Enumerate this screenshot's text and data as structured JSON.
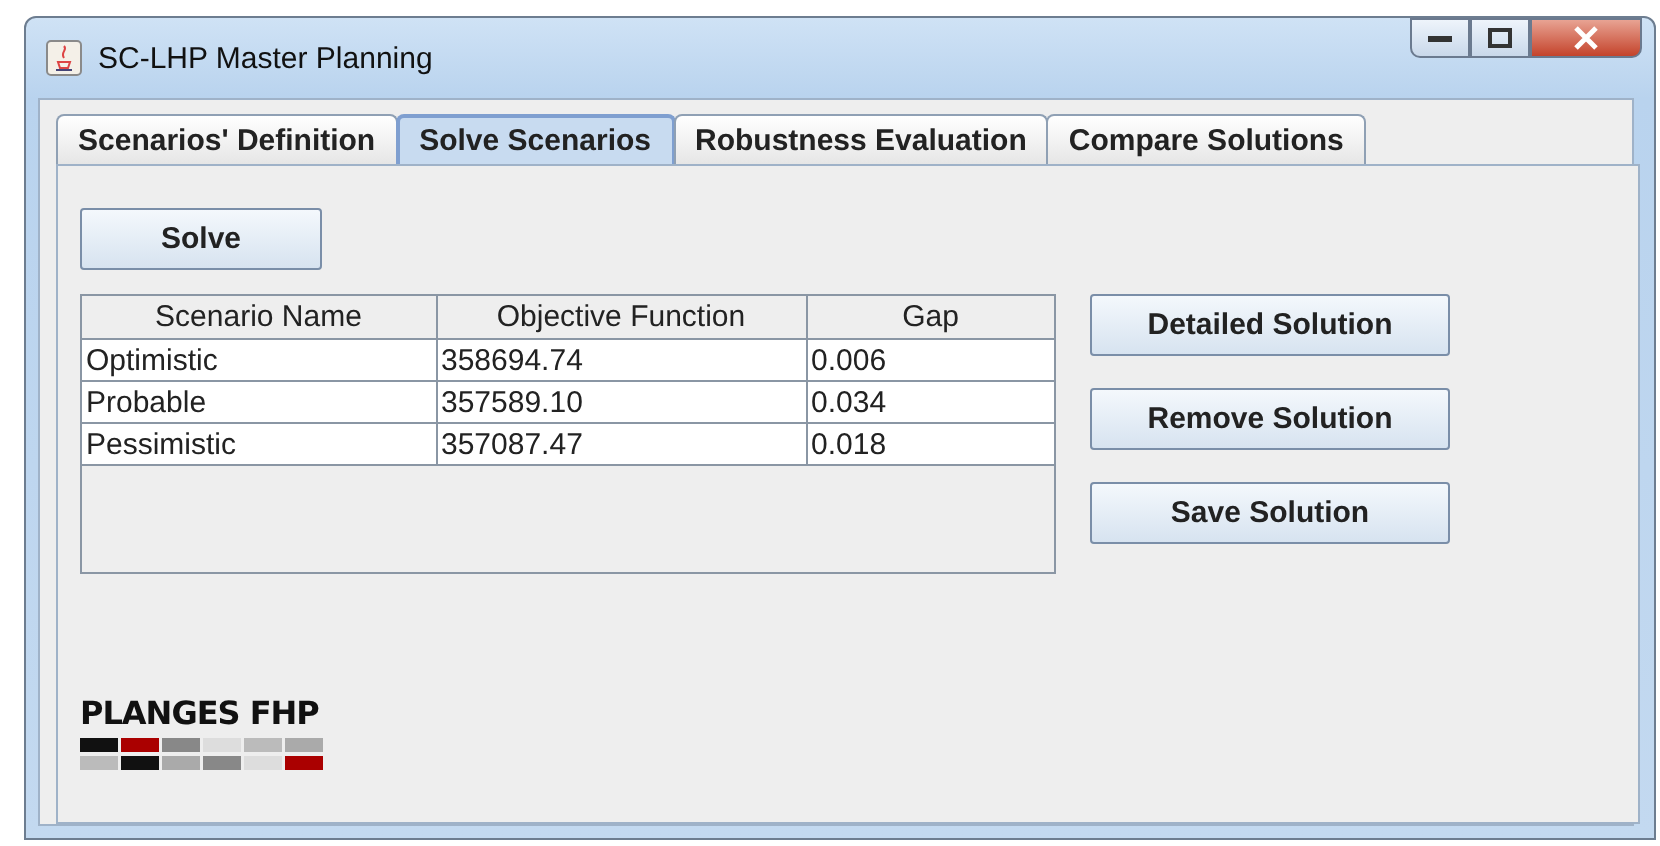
{
  "window": {
    "title": "SC-LHP Master Planning"
  },
  "tabs": [
    {
      "label": "Scenarios' Definition",
      "selected": false
    },
    {
      "label": "Solve Scenarios",
      "selected": true
    },
    {
      "label": "Robustness Evaluation",
      "selected": false
    },
    {
      "label": "Compare Solutions",
      "selected": false
    }
  ],
  "solve_button": "Solve",
  "table": {
    "columns": [
      "Scenario Name",
      "Objective Function",
      "Gap"
    ],
    "rows": [
      [
        "Optimistic",
        "358694.74",
        "0.006"
      ],
      [
        "Probable",
        "357589.10",
        "0.034"
      ],
      [
        "Pessimistic",
        "357087.47",
        "0.018"
      ]
    ]
  },
  "actions": [
    "Detailed Solution",
    "Remove Solution",
    "Save Solution"
  ],
  "logo": {
    "text": "PLANGES FHP"
  }
}
